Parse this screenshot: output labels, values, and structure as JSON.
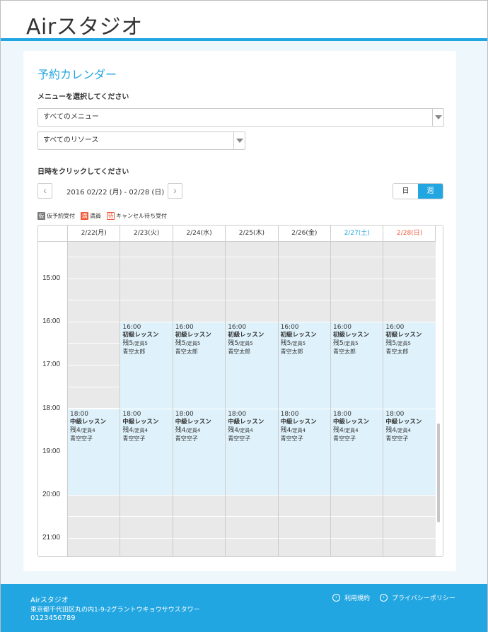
{
  "header": {
    "logo": "Airスタジオ"
  },
  "page": {
    "title": "予約カレンダー",
    "menu_label": "メニューを選択してください",
    "menu_select": "すべてのメニュー",
    "resource_select": "すべてのリソース",
    "date_label": "日時をクリックしてください",
    "prev_icon": "‹",
    "next_icon": "›",
    "range": "2016 02/22 (月) - 02/28 (日)",
    "view_day": "日",
    "view_week": "週"
  },
  "legend": [
    {
      "badge": "仮",
      "label": "仮予約受付"
    },
    {
      "badge": "満",
      "label": "満員"
    },
    {
      "badge": "待",
      "label": "キャンセル待ち受付"
    }
  ],
  "calendar": {
    "days": [
      {
        "label": "2/22(月)",
        "color": "#333333"
      },
      {
        "label": "2/23(火)",
        "color": "#333333"
      },
      {
        "label": "2/24(水)",
        "color": "#333333"
      },
      {
        "label": "2/25(木)",
        "color": "#333333"
      },
      {
        "label": "2/26(金)",
        "color": "#333333"
      },
      {
        "label": "2/27(土)",
        "color": "#22a6e1"
      },
      {
        "label": "2/28(日)",
        "color": "#ee5a3a"
      }
    ],
    "times": [
      "15:00",
      "16:00",
      "17:00",
      "18:00",
      "19:00",
      "20:00",
      "21:00"
    ],
    "beginner": {
      "time": "16:00",
      "name": "初級レッスン",
      "remain": "残5",
      "capacity": "/定員5",
      "staff": "青空太郎"
    },
    "intermediate": {
      "time": "18:00",
      "name": "中級レッスン",
      "remain": "残4",
      "capacity": "/定員4",
      "staff": "青空空子"
    }
  },
  "footer": {
    "name": "Airスタジオ",
    "address": "東京都千代田区丸の内1-9-2グラントウキョウサウスタワー",
    "tel": "0123456789",
    "terms": "利用規約",
    "privacy": "プライバシーポリシー"
  }
}
